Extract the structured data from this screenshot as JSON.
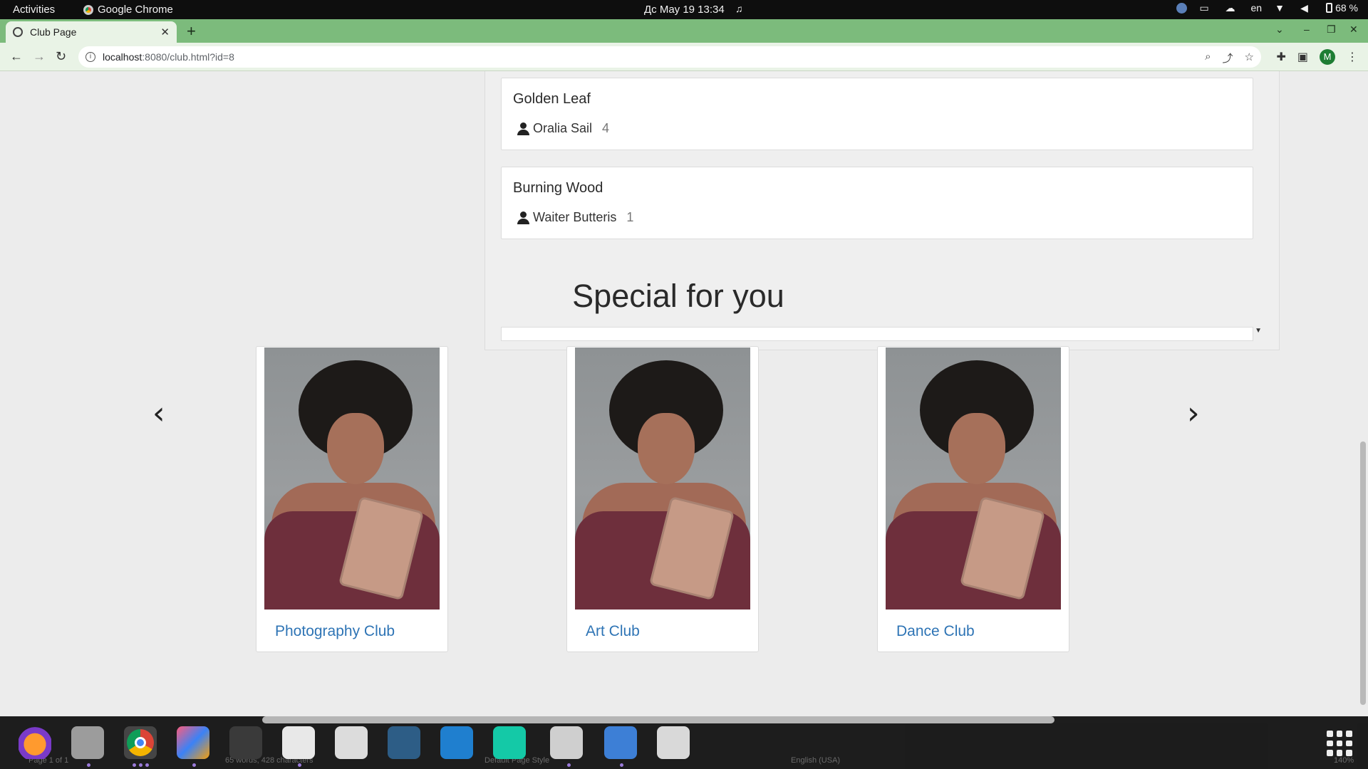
{
  "system_bar": {
    "activities": "Activities",
    "app_name": "Google Chrome",
    "datetime": "Дс May 19  13:34",
    "language": "en",
    "battery": "68 %"
  },
  "browser": {
    "tab_title": "Club Page",
    "url_host": "localhost",
    "url_path": ":8080/club.html?id=8",
    "profile_initial": "M"
  },
  "books": [
    {
      "title": "Golden Leaf",
      "author": "Oralia Sail",
      "count": "4"
    },
    {
      "title": "Burning Wood",
      "author": "Waiter Butteris",
      "count": "1"
    }
  ],
  "special": {
    "title": "Special for you",
    "prev_glyph": "‹",
    "next_glyph": "›",
    "clubs": [
      {
        "name": "Photography Club"
      },
      {
        "name": "Art Club"
      },
      {
        "name": "Dance Club"
      }
    ]
  },
  "dock_status": {
    "page": "Page 1 of 1",
    "words": "65 words, 428 characters",
    "style": "Default Page Style",
    "lang": "English (USA)",
    "zoom": "140%"
  },
  "icons": [
    "chrome-icon",
    "bell-off-icon",
    "wifi-icon",
    "volume-icon",
    "battery-icon",
    "globe-icon",
    "back-icon",
    "forward-icon",
    "reload-icon",
    "zoom-icon",
    "share-icon",
    "star-icon",
    "extensions-icon",
    "sidepanel-icon",
    "menu-icon",
    "person-icon",
    "chevron-left-icon",
    "chevron-right-icon",
    "app-grid-icon"
  ]
}
